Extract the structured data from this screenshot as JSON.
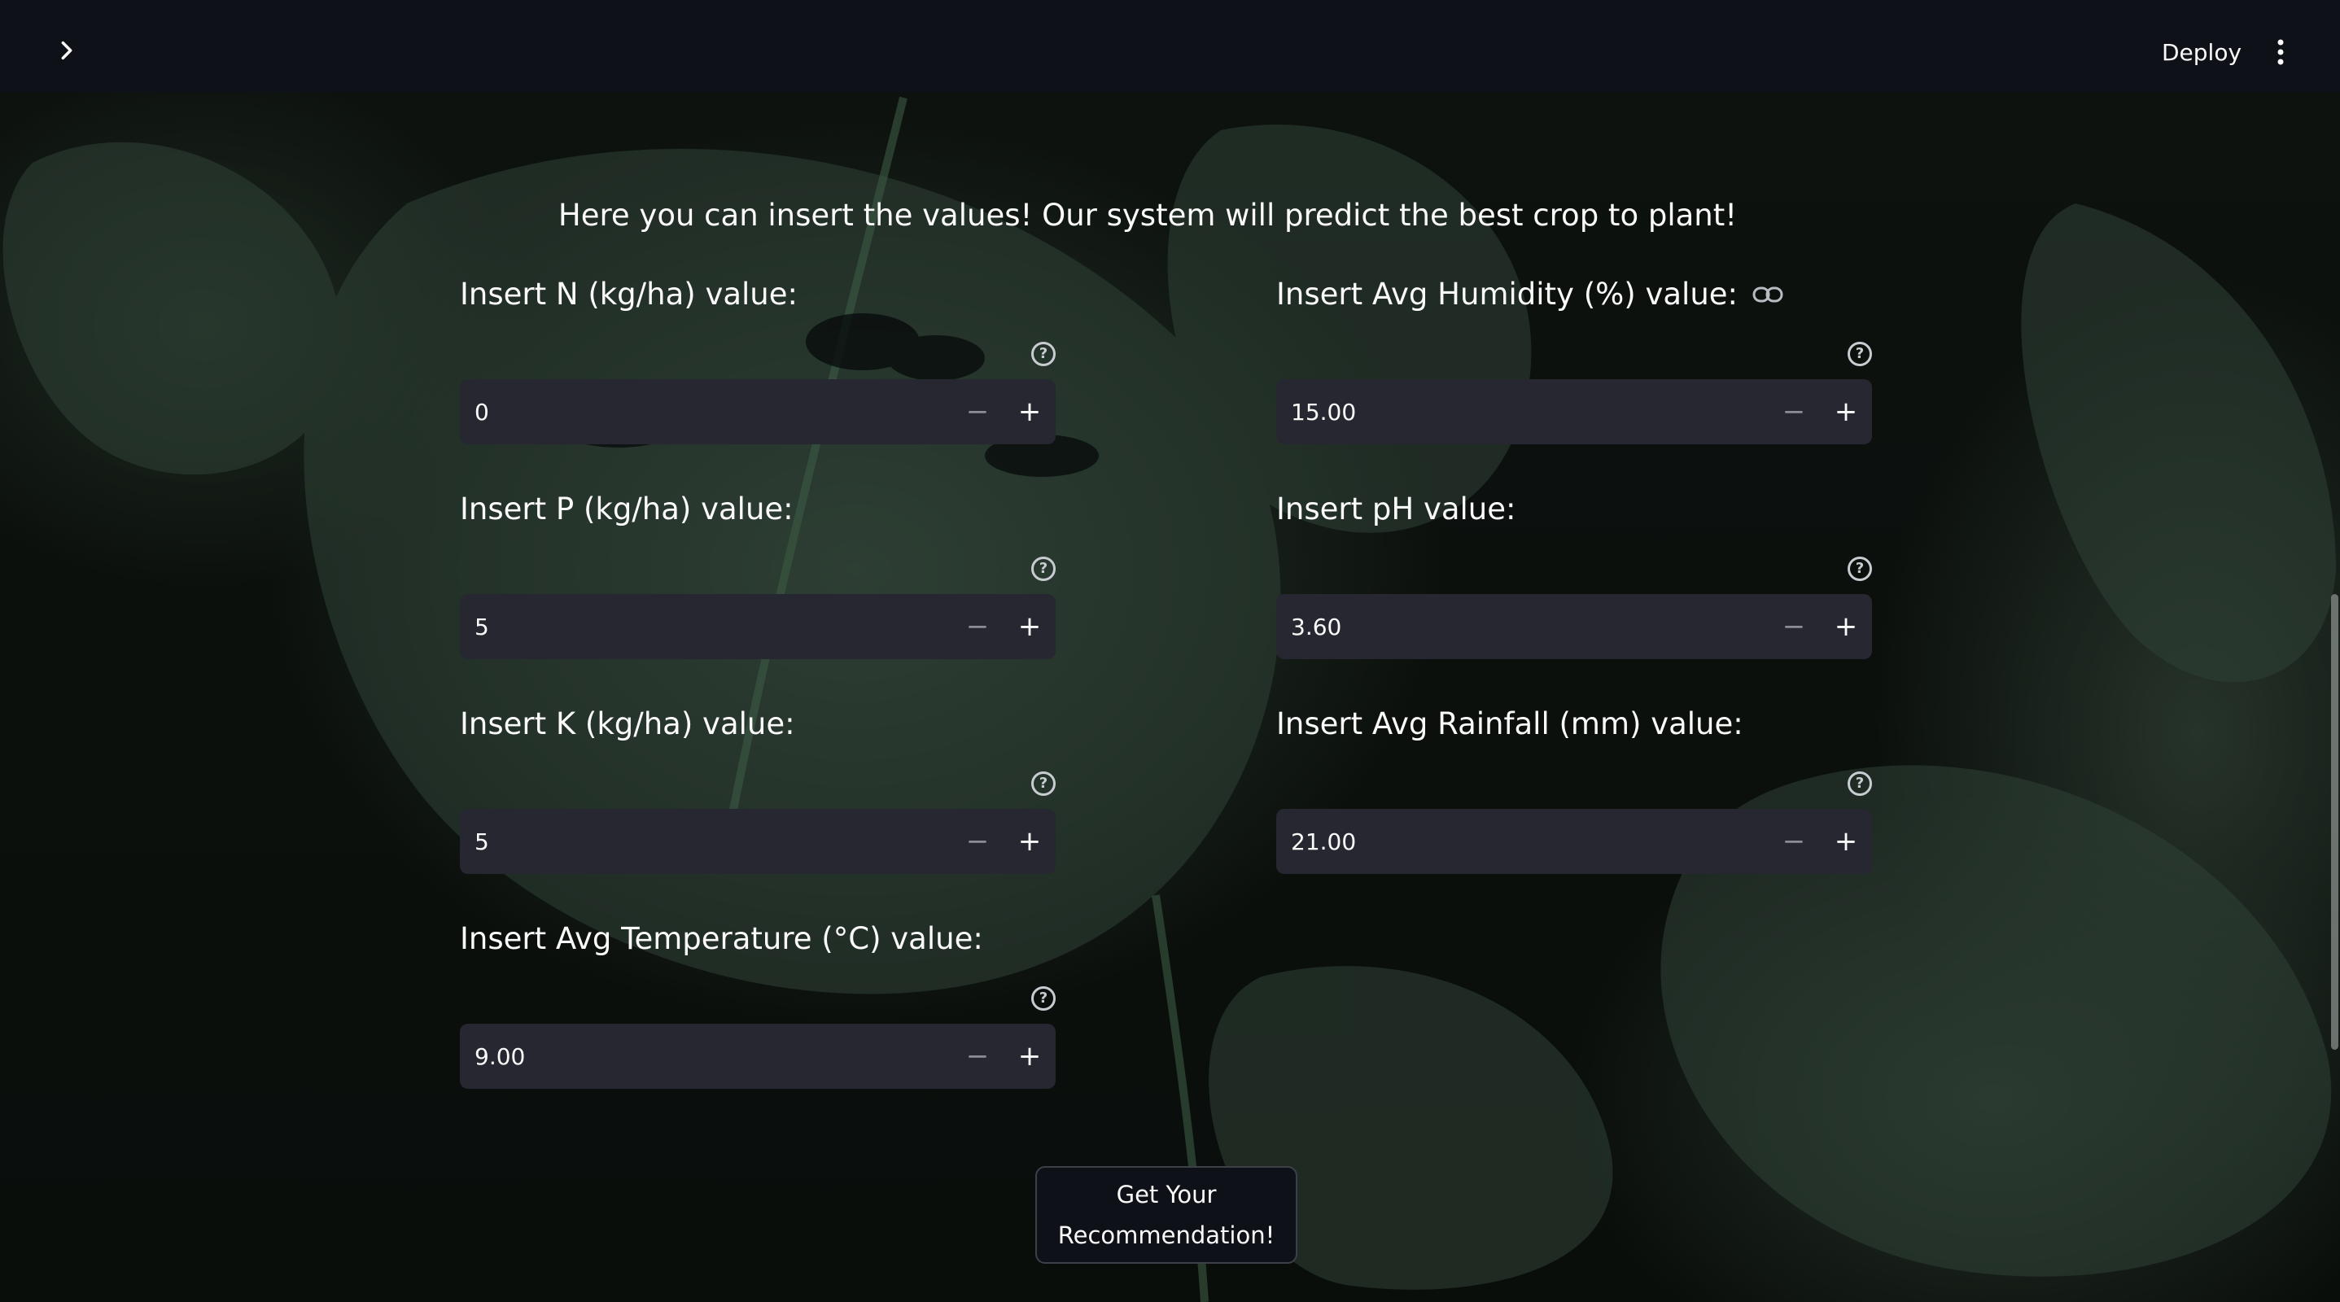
{
  "header": {
    "sidebar_toggle_icon": "chevron-right-icon",
    "deploy_label": "Deploy",
    "menu_icon": "vertical-ellipsis-icon"
  },
  "main": {
    "intro": "Here you can insert the values! Our system will predict the best crop to plant!",
    "help_icon": "question-circle-icon",
    "fields": [
      {
        "id": "n",
        "label": "Insert N (kg/ha) value:",
        "value": "0"
      },
      {
        "id": "humidity",
        "label": "Insert Avg Humidity (%) value:",
        "value": "15.00",
        "has_link_icon": true
      },
      {
        "id": "p",
        "label": "Insert P (kg/ha) value:",
        "value": "5"
      },
      {
        "id": "ph",
        "label": "Insert pH value:",
        "value": "3.60"
      },
      {
        "id": "k",
        "label": "Insert K (kg/ha) value:",
        "value": "5"
      },
      {
        "id": "rainfall",
        "label": "Insert Avg Rainfall (mm) value:",
        "value": "21.00"
      },
      {
        "id": "temperature",
        "label": "Insert Avg Temperature (°C) value:",
        "value": "9.00"
      }
    ],
    "minus_symbol": "−",
    "plus_symbol": "+",
    "submit_label": "Get Your Recommendation!"
  },
  "colors": {
    "header_bg": "#0e1117",
    "input_bg": "#262730",
    "text": "#fafafa"
  }
}
